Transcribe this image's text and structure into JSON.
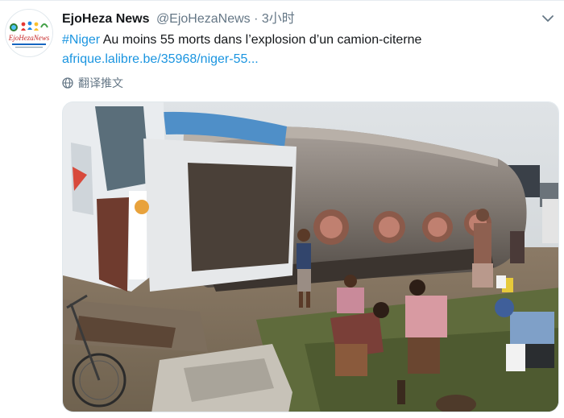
{
  "tweet": {
    "display_name": "EjoHeza News",
    "handle": "@EjoHezaNews",
    "separator": "·",
    "time": "3小时",
    "hashtag": "#Niger",
    "body": " Au moins 55 morts dans l’explosion d’un camion-citerne",
    "link": "afrique.lalibre.be/35968/niger-55...",
    "translate_label": "翻译推文",
    "avatar_text": "EjoHezaNews"
  },
  "colors": {
    "link": "#1b95e0",
    "secondary_text": "#657786"
  },
  "icons": {
    "more": "chevron-down-icon",
    "translate": "globe-icon"
  }
}
